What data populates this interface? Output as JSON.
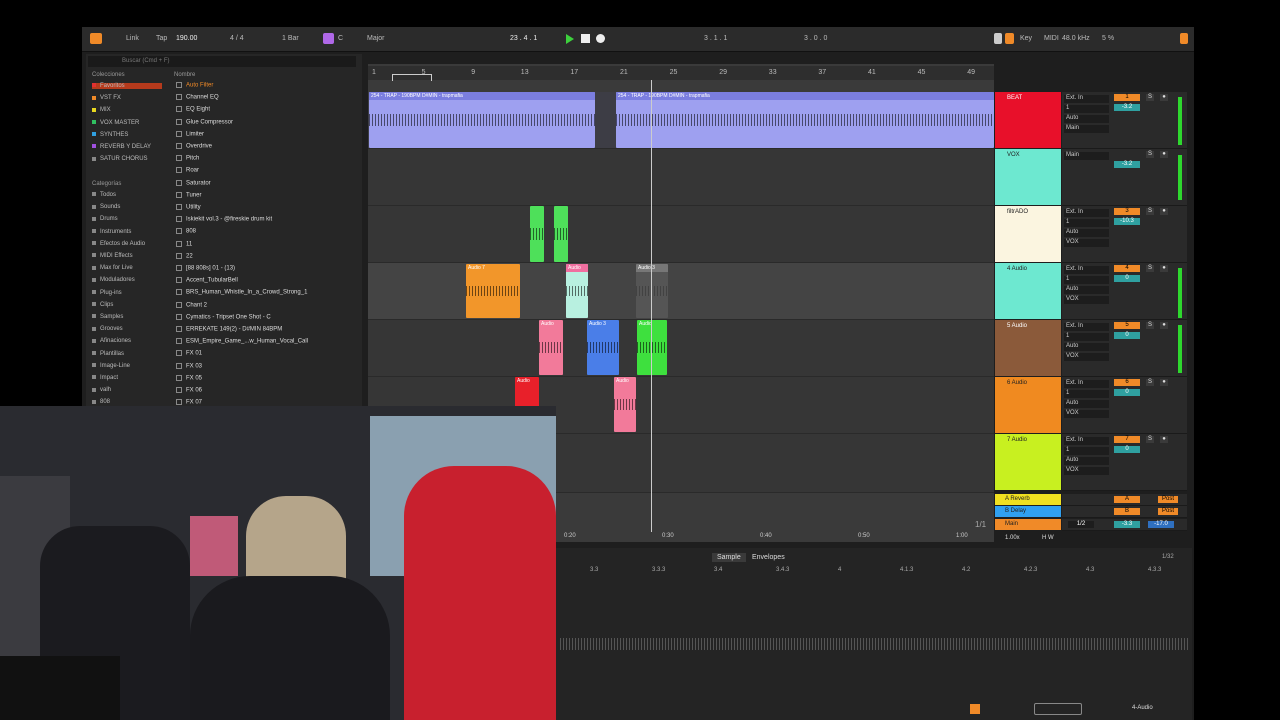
{
  "topbar": {
    "link": "Link",
    "tap": "Tap",
    "tempo": "190.00",
    "time_sig": "4 / 4",
    "bar": "1 Bar",
    "key": "C",
    "scale": "Major",
    "position": "23 .  4 .  1",
    "loop_start": "3 .  1 .  1",
    "loop_len": "3 .  0 .  0",
    "key_label": "Key",
    "midi_label": "MIDI",
    "sample_rate": "48.0 kHz",
    "cpu": "5 %"
  },
  "browser": {
    "search_placeholder": "Buscar (Cmd + F)",
    "collections_title": "Colecciones",
    "name_header": "Nombre",
    "collections": [
      {
        "label": "Favoritos",
        "color": "#e23030"
      },
      {
        "label": "VST FX",
        "color": "#f08a28"
      },
      {
        "label": "MIX",
        "color": "#e8d820"
      },
      {
        "label": "VOX MASTER",
        "color": "#30c060"
      },
      {
        "label": "SYNTHES",
        "color": "#30a0e0"
      },
      {
        "label": "REVERB Y DELAY",
        "color": "#a050e0"
      },
      {
        "label": "SATUR CHORUS",
        "color": "#888888"
      }
    ],
    "categories_title": "Categorías",
    "categories": [
      "Todos",
      "Sounds",
      "Drums",
      "Instruments",
      "Efectos de Audio",
      "MIDI Effects",
      "Max for Live",
      "Moduladores",
      "Plug-ins",
      "Clips",
      "Samples",
      "Grooves",
      "Afinaciones",
      "Plantillas",
      "Image-Line",
      "Impact",
      "valh",
      "808"
    ],
    "files": [
      "Auto Filter",
      "Channel EQ",
      "EQ Eight",
      "Glue Compressor",
      "Limiter",
      "Overdrive",
      "Pitch",
      "Roar",
      "Saturator",
      "Tuner",
      "Utility",
      "Iskiekit vol.3 - @fireskie drum kit",
      "808",
      "11",
      "22",
      "[88 808s] 01 - (13)",
      "Accent_TubularBell",
      "BRS_Human_Whistle_In_a_Crowd_Strong_1",
      "Chant 2",
      "Cymatics - Tripset One Shot - C",
      "ERREKATE 149(2) - D#MIN 84BPM",
      "ESM_Empire_Game_...w_Human_Vocal_Call",
      "FX 01",
      "FX 03",
      "FX 05",
      "FX 06",
      "FX 07"
    ]
  },
  "ruler": [
    "1",
    "5",
    "9",
    "13",
    "17",
    "21",
    "25",
    "29",
    "33",
    "37",
    "41",
    "45",
    "49"
  ],
  "clips": {
    "trap1": "254 - TRAP - 190BPM D#MIN - trapmafia",
    "trap2": "254 - TRAP - 190BPM D#MIN - trapmafia",
    "audio7": "Audio 7",
    "audio_a": "Audio",
    "audio_b": "Audio 3",
    "audio_c": "Audio",
    "audio_d": "Audio 3",
    "audio_e": "Audio",
    "audio_f": "Audio",
    "audio_g": "Audio"
  },
  "tracks": [
    {
      "name": "BEAT",
      "color": "#e8102a",
      "input": "Ext. In",
      "route": "1",
      "mon": "Auto",
      "vol": "1",
      "db": "-3.2",
      "out": "Main"
    },
    {
      "name": "VOX",
      "color": "#6de8d0",
      "input": "Main",
      "route": "",
      "mon": "",
      "vol": "",
      "db": "-3.2",
      "out": ""
    },
    {
      "name": "filtrADO",
      "color": "#fbf5e0",
      "input": "Ext. In",
      "route": "1",
      "mon": "Auto",
      "vol": "3",
      "db": "-10.3",
      "out": "VOX"
    },
    {
      "name": "4 Audio",
      "color": "#6de8d0",
      "input": "Ext. In",
      "route": "1",
      "mon": "Auto",
      "vol": "4",
      "db": "0",
      "out": "VOX"
    },
    {
      "name": "5 Audio",
      "color": "#8b5a3a",
      "input": "Ext. In",
      "route": "1",
      "mon": "Auto",
      "vol": "5",
      "db": "0",
      "out": "VOX"
    },
    {
      "name": "6 Audio",
      "color": "#f08a20",
      "input": "Ext. In",
      "route": "1",
      "mon": "Auto",
      "vol": "6",
      "db": "0",
      "out": "VOX"
    },
    {
      "name": "7 Audio",
      "color": "#c8f020",
      "input": "Ext. In",
      "route": "1",
      "mon": "Auto",
      "vol": "7",
      "db": "0",
      "out": "VOX"
    }
  ],
  "returns": [
    {
      "name": "A Reverb",
      "color": "#f0e020",
      "vol": "A",
      "post": "Post"
    },
    {
      "name": "B Delay",
      "color": "#30a0f0",
      "vol": "B",
      "post": "Post"
    }
  ],
  "main": {
    "name": "Main",
    "route": "1/2",
    "db": "-3.3",
    "db2": "-17.0"
  },
  "timeline": [
    "0:20",
    "0:30",
    "0:40",
    "0:50",
    "1:00"
  ],
  "page_indicator": "1/1",
  "zoom": "1.00x",
  "hw": "H  W",
  "sample_view": {
    "tab_sample": "Sample",
    "tab_envelopes": "Envelopes",
    "ratio": "1/32",
    "ticks": [
      "3.3",
      "3.3.3",
      "3.4",
      "3.4.3",
      "4",
      "4.1.3",
      "4.2",
      "4.2.3",
      "4.3",
      "4.3.3"
    ],
    "track_label": "4-Audio"
  }
}
